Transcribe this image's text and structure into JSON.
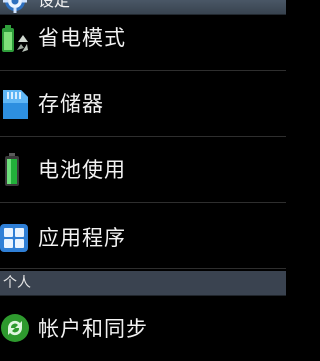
{
  "header": {
    "title": "设定",
    "icon": "gear-icon"
  },
  "items": [
    {
      "label": "省电模式",
      "icon": "power-saving-icon"
    },
    {
      "label": "存储器",
      "icon": "sd-card-icon"
    },
    {
      "label": "电池使用",
      "icon": "battery-icon"
    },
    {
      "label": "应用程序",
      "icon": "apps-grid-icon"
    }
  ],
  "section": {
    "title": "个人"
  },
  "partial_item": {
    "label": "帐户和同步",
    "icon": "sync-icon"
  }
}
